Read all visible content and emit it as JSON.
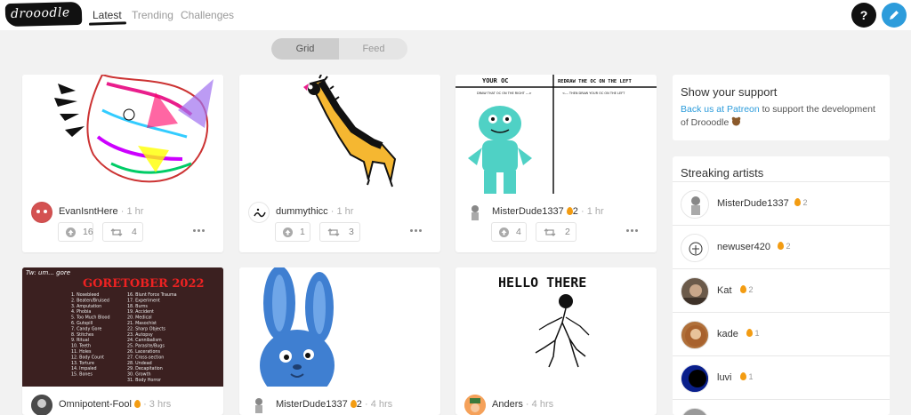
{
  "app": {
    "logo": "drooodle"
  },
  "nav": {
    "items": [
      "Latest",
      "Trending",
      "Challenges"
    ],
    "help_label": "?"
  },
  "view_toggle": {
    "options": [
      "Grid",
      "Feed"
    ],
    "selected": "Grid"
  },
  "posts": [
    {
      "title": "EvanIsntHere",
      "user": "EvanIsntHere",
      "sep": "·",
      "time": "1 hr",
      "streak": "",
      "likes": "16",
      "reposts": "4"
    },
    {
      "user": "dummythicc",
      "sep": "·",
      "time": "1 hr",
      "streak": "",
      "likes": "1",
      "reposts": "3"
    },
    {
      "user": "MisterDude1337",
      "sep": "·",
      "time": "1 hr",
      "streak": "2",
      "likes": "4",
      "reposts": "2"
    },
    {
      "user": "Omnipotent-Fool",
      "sep": "·",
      "time": "3 hrs",
      "streak": "",
      "likes": "",
      "reposts": ""
    },
    {
      "user": "MisterDude1337",
      "sep": "·",
      "time": "4 hrs",
      "streak": "2",
      "likes": "",
      "reposts": ""
    },
    {
      "user": "Anders",
      "sep": "·",
      "time": "4 hrs",
      "streak": "",
      "likes": "",
      "reposts": ""
    }
  ],
  "art_text": {
    "oc_left": "YOUR OC",
    "oc_left_sub": "DRAW THAT OC ON THE RIGHT --->",
    "oc_right": "REDRAW THE OC ON THE LEFT",
    "oc_right_sub": "<--- THEN DRAW YOUR OC ON THE LEFT",
    "goretober_top": "Tw: um... gore",
    "goretober_title": "GORETOBER 2022",
    "goretober_col1": [
      "1. Nosebleed",
      "2. Beaten/Bruised",
      "3. Amputation",
      "4. Phobia",
      "5. Too Much Blood",
      "6. Gutspill",
      "7. Candy Gore",
      "8. Stitches",
      "9. Ritual",
      "10. Teeth",
      "11. Holes",
      "12. Body Count",
      "13. Torture",
      "14. Impaled",
      "15. Bones"
    ],
    "goretober_col2": [
      "16. Blunt Force Trauma",
      "17. Experiment",
      "18. Burns",
      "19. Accident",
      "20. Medical",
      "21. Masochist",
      "22. Sharp Objects",
      "23. Autopsy",
      "24. Cannibalism",
      "25. Parasite/Bugs",
      "26. Lacerations",
      "27. Cross-section",
      "28. Undead",
      "29. Decapitation",
      "30. Growth",
      "31. Body Horror"
    ],
    "hello": "HELLO THERE"
  },
  "sidebar": {
    "support": {
      "title": "Show your support",
      "link": "Back us at Patreon",
      "text": " to support the development of Drooodle"
    },
    "streaking": {
      "title": "Streaking artists",
      "artists": [
        {
          "name": "MisterDude1337",
          "streak": "2"
        },
        {
          "name": "newuser420",
          "streak": "2"
        },
        {
          "name": "Kat",
          "streak": "2"
        },
        {
          "name": "kade",
          "streak": "1"
        },
        {
          "name": "luvi",
          "streak": "1"
        }
      ]
    }
  },
  "colors": {
    "accent": "#2d9cdb",
    "flame": "#f39c12",
    "background": "#f2f2f2"
  },
  "icons": {
    "help": "question-icon",
    "edit": "pencil-icon",
    "like": "arrow-up-circle-icon",
    "repost": "repost-icon",
    "more": "ellipsis-icon",
    "streak": "flame-icon"
  }
}
